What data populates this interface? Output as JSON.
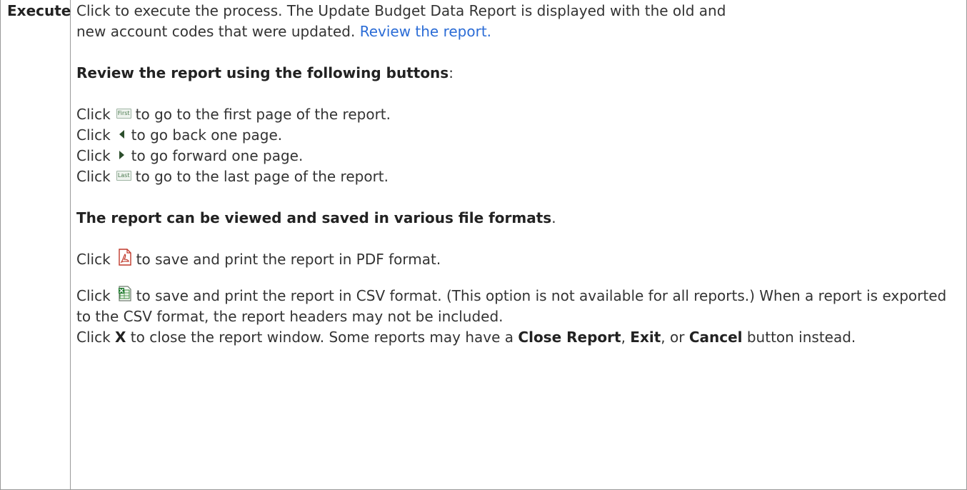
{
  "row": {
    "term": "Execute",
    "intro_1": "Click to execute the process. The Update Budget Data Report is displayed with the old and",
    "intro_2": "new account codes that were updated. ",
    "review_link": "Review the report.",
    "review_heading": "Review the report using the following buttons",
    "colon": ":",
    "nav": [
      {
        "pre": "Click",
        "icon": "first-page-icon",
        "icon_label": "First",
        "post": "to go to the first page of the report."
      },
      {
        "pre": "Click",
        "icon": "previous-page-icon",
        "icon_label": "",
        "post": "to go back one page."
      },
      {
        "pre": "Click",
        "icon": "next-page-icon",
        "icon_label": "",
        "post": "to go forward one page."
      },
      {
        "pre": "Click",
        "icon": "last-page-icon",
        "icon_label": "Last",
        "post": "to go to the last page of the report."
      }
    ],
    "formats_heading": "The report can be viewed and saved in various file formats",
    "period": ".",
    "pdf": {
      "pre": "Click",
      "icon": "pdf-icon",
      "post": "to save and print the report in PDF format."
    },
    "csv": {
      "pre": "Click",
      "icon": "csv-excel-icon",
      "post": "to save and print the report in CSV format. (This option is not available for all reports.) When a report is exported to the CSV format, the report headers may not be included."
    },
    "close": {
      "pre": "Click ",
      "x": "X",
      "mid": " to close the report window. Some reports may have a ",
      "close_report": "Close Report",
      "comma": ", ",
      "exit": "Exit",
      "or": ", or",
      "cancel": "Cancel",
      "end": " button instead."
    }
  },
  "colors": {
    "link": "#2b6cd6",
    "border": "#9a9a9a",
    "text": "#333333"
  }
}
